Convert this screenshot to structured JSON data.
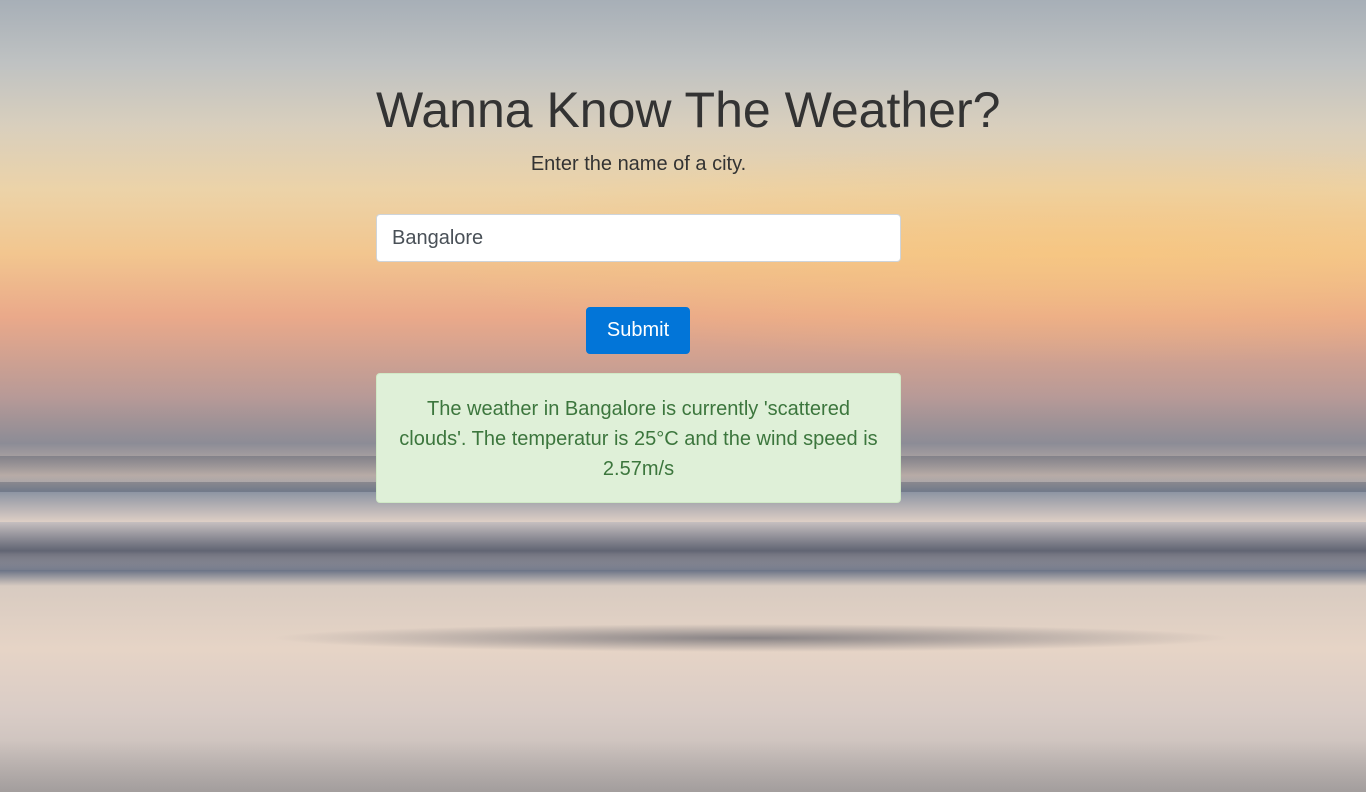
{
  "header": {
    "title": "Wanna Know The Weather?",
    "subtitle": "Enter the name of a city."
  },
  "form": {
    "city_value": "Bangalore",
    "submit_label": "Submit"
  },
  "result": {
    "message": "The weather in Bangalore is currently 'scattered clouds'. The temperatur is 25°C and the wind speed is 2.57m/s"
  },
  "colors": {
    "primary_button": "#0275d8",
    "success_background": "#dff0d8",
    "success_text": "#3c763d",
    "heading_text": "#333333"
  }
}
